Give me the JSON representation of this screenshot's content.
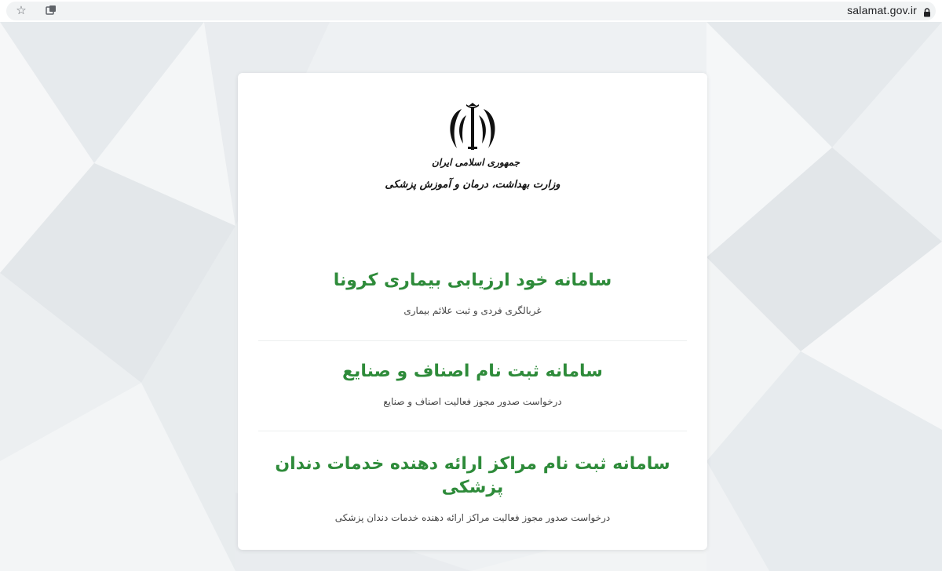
{
  "browser": {
    "url": "salamat.gov.ir",
    "icons": [
      "star-icon",
      "extension-icon",
      "lock-icon"
    ]
  },
  "header": {
    "emblem_icon": "iran-emblem-icon",
    "line1": "جمهوری اسلامی ایران",
    "line2": "وزارت بهداشت، درمان و آموزش پزشکی"
  },
  "services": [
    {
      "title": "سامانه خود ارزیابی بیماری کرونا",
      "description": "غربالگری فردی و ثبت علائم بیماری"
    },
    {
      "title": "سامانه ثبت نام اصناف و صنایع",
      "description": "درخواست صدور مجوز فعالیت اصناف و صنایع"
    },
    {
      "title": "سامانه ثبت نام مراکز ارائه دهنده خدمات دندان پزشکی",
      "description": "درخواست صدور مجوز فعالیت مراکز ارائه دهنده خدمات دندان پزشکی"
    }
  ],
  "colors": {
    "accent_green": "#2e8b3a",
    "background": "#eef1f3",
    "card": "#ffffff"
  }
}
